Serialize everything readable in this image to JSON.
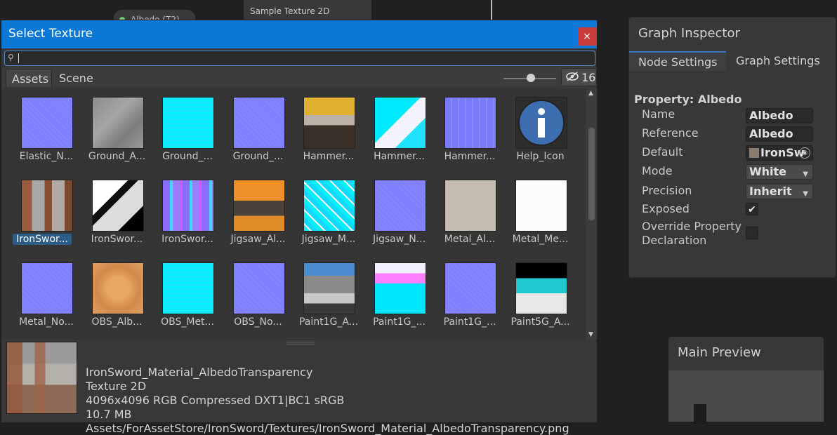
{
  "background": {
    "node_label": "Albedo (T2)",
    "sample_node_title": "Sample Texture 2D"
  },
  "dialog": {
    "title": "Select Texture",
    "close_symbol": "×",
    "search": {
      "value": "",
      "placeholder": ""
    },
    "tabs": [
      {
        "label": "Assets"
      },
      {
        "label": "Scene"
      }
    ],
    "hidden_count": "16",
    "items": [
      {
        "label": "Elastic_N...",
        "kind": "normal"
      },
      {
        "label": "Ground_A...",
        "kind": "gray"
      },
      {
        "label": "Ground_...",
        "kind": "cyan"
      },
      {
        "label": "Ground_...",
        "kind": "normal"
      },
      {
        "label": "Hammer...",
        "kind": "hammer"
      },
      {
        "label": "Hammer...",
        "kind": "cyan-white"
      },
      {
        "label": "Hammer...",
        "kind": "normal-detail"
      },
      {
        "label": "Help_Icon",
        "kind": "help"
      },
      {
        "label": "IronSwor...",
        "kind": "rust",
        "selected": true
      },
      {
        "label": "IronSwor...",
        "kind": "bw"
      },
      {
        "label": "IronSwor...",
        "kind": "purple-mosaic"
      },
      {
        "label": "Jigsaw_Al...",
        "kind": "orange"
      },
      {
        "label": "Jigsaw_M...",
        "kind": "cyan-mosaic"
      },
      {
        "label": "Jigsaw_N...",
        "kind": "normal"
      },
      {
        "label": "Metal_Al...",
        "kind": "beige"
      },
      {
        "label": "Metal_Me...",
        "kind": "white"
      },
      {
        "label": "Metal_No...",
        "kind": "normal"
      },
      {
        "label": "OBS_Alb...",
        "kind": "sand"
      },
      {
        "label": "OBS_Met...",
        "kind": "cyan"
      },
      {
        "label": "OBS_No...",
        "kind": "normal"
      },
      {
        "label": "Paint1G_A...",
        "kind": "paint-a"
      },
      {
        "label": "Paint1G_...",
        "kind": "paint-b"
      },
      {
        "label": "Paint1G_...",
        "kind": "normal"
      },
      {
        "label": "Paint5G_A...",
        "kind": "paint5"
      }
    ],
    "details": {
      "name": "IronSword_Material_AlbedoTransparency",
      "type": "Texture 2D",
      "format": "4096x4096  RGB Compressed DXT1|BC1 sRGB",
      "size": "10.7 MB",
      "path": "Assets/ForAssetStore/IronSword/Textures/IronSword_Material_AlbedoTransparency.png"
    }
  },
  "inspector": {
    "title": "Graph Inspector",
    "tabs": [
      {
        "label": "Node Settings"
      },
      {
        "label": "Graph Settings"
      }
    ],
    "property_title": "Property: Albedo",
    "rows": {
      "name": {
        "label": "Name",
        "value": "Albedo"
      },
      "reference": {
        "label": "Reference",
        "value": "Albedo"
      },
      "default": {
        "label": "Default",
        "value": "IronSw"
      },
      "mode": {
        "label": "Mode",
        "value": "White"
      },
      "precision": {
        "label": "Precision",
        "value": "Inherit"
      },
      "exposed": {
        "label": "Exposed",
        "checked": true
      },
      "override": {
        "label1": "Override Property",
        "label2": "Declaration",
        "checked": false
      }
    }
  },
  "preview": {
    "title": "Main Preview"
  },
  "icons": {
    "search": "search-icon",
    "eye_slash": "eye-slash-icon",
    "close": "close-icon",
    "dropdown": "chevron-down-icon",
    "object_picker": "object-picker-icon",
    "check": "check-icon"
  },
  "colors": {
    "titlebar": "#0b78d7",
    "close": "#c83c3c",
    "selection": "#2c5d87",
    "normal_map": "#7f7fff",
    "cyan_map": "#00ffff"
  }
}
